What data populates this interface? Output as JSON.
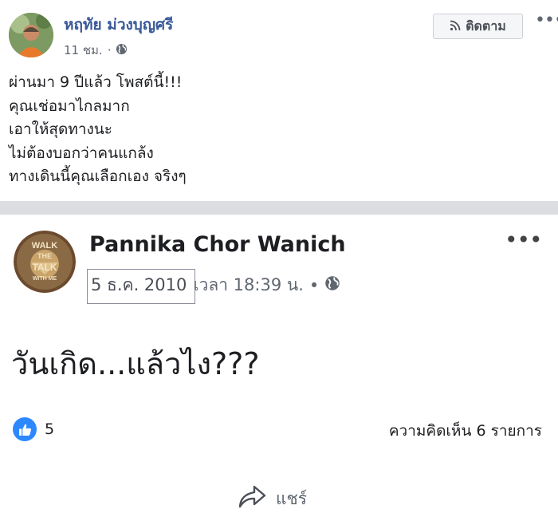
{
  "post": {
    "author": "หฤทัย ม่วงบุญศรี",
    "time": "11 ชม.",
    "audience_icon": "globe-icon",
    "follow_label": "ติดตาม",
    "more_icon": "more-horizontal-icon",
    "lines": [
      "ผ่านมา 9 ปีแล้ว โพสต์นี้!!!",
      "คุณเช่อมาไกลมาก",
      "เอาให้สุดทางนะ",
      "ไม่ต้องบอกว่าคนแกล้ง",
      "ทางเดินนี้คุณเลือกเอง จริงๆ"
    ]
  },
  "shared": {
    "author": "Pannika Chor Wanich",
    "date": "5 ธ.ค. 2010",
    "time": "เวลา 18:39 น.",
    "separator": "•",
    "text": "วันเกิด...แล้วไง???",
    "avatar_text": [
      "WALK",
      "THE",
      "TALK",
      "WITH ME"
    ],
    "likes": "5",
    "comments": "ความคิดเห็น 6 รายการ",
    "share_label": "แชร์"
  },
  "colors": {
    "link_blue": "#385898",
    "like_blue": "#2d88ff",
    "secondary_text": "#606770",
    "separator": "#dcdde0"
  }
}
